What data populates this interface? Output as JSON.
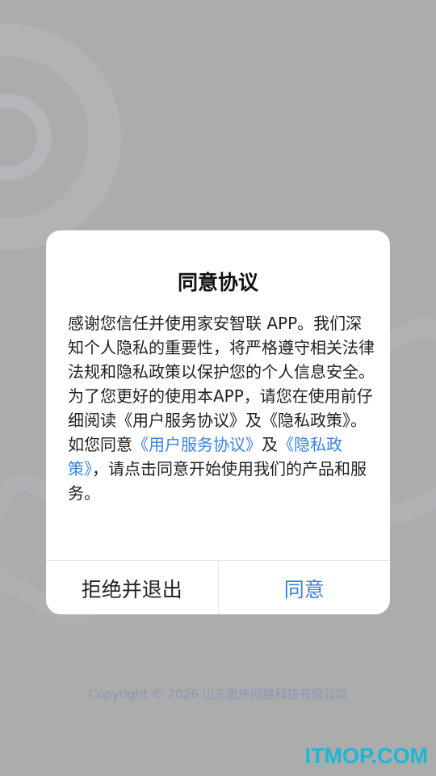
{
  "dialog": {
    "title": "同意协议",
    "para1": "感谢您信任并使用家安智联 APP。我们深知个人隐私的重要性，将严格遵守相关法律法规和隐私政策以保护您的个人信息安全。为了您更好的使用本APP，请您在使用前仔细阅读《用户服务协议》及《隐私政策》。",
    "para2_prefix": "如您同意",
    "link_service": "《用户服务协议》",
    "para2_and": "及",
    "link_privacy": "《隐私政策》",
    "para2_suffix": "，请点击同意开始使用我们的产品和服务。",
    "reject_label": "拒绝并退出",
    "agree_label": "同意"
  },
  "footer": {
    "copyright": "Copyright © 2026 山东思序网络科技有限公司"
  },
  "watermark": "ITMOP.COM",
  "colors": {
    "background": "#acacac",
    "accent": "#3a82e0",
    "copyright": "#8a98b4",
    "watermark": "#19b8d8"
  }
}
